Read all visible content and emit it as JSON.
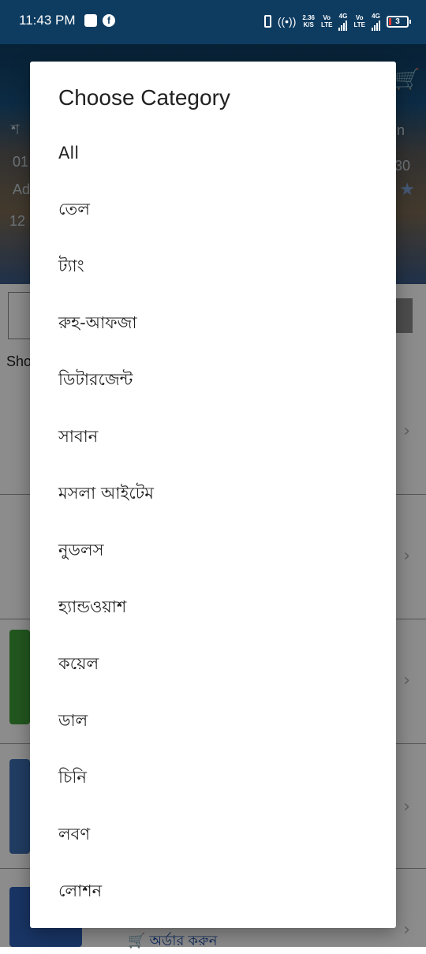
{
  "status_bar": {
    "time": "11:43 PM",
    "data_speed_value": "2.36",
    "data_speed_unit": "K/S",
    "sim1_volte_top": "Vo",
    "sim1_volte_bottom": "LTE",
    "sim1_network": "4G",
    "sim2_volte_top": "Vo",
    "sim2_volte_bottom": "LTE",
    "sim2_network": "4G",
    "battery_level": "3"
  },
  "background": {
    "header_fragments": [
      "শ",
      "01",
      "Ad",
      "12"
    ],
    "header_fragments_right": [
      "n",
      "30"
    ],
    "sho_fragment": "Sho",
    "order_fragment": "অর্ডার করুন"
  },
  "dialog": {
    "title": "Choose Category",
    "categories": [
      "All",
      "তেল",
      "ট্যাং",
      "রুহ-আফজা",
      "ডিটারজেন্ট",
      "সাবান",
      "মসলা আইটেম",
      "নুডলস",
      "হ্যান্ডওয়াশ",
      "কয়েল",
      "ডাল",
      "চিনি",
      "লবণ",
      "লোশন"
    ]
  },
  "colors": {
    "status_bar_bg": "#0e3c61",
    "scrim": "rgba(0,0,0,0.45)",
    "dialog_bg": "#ffffff",
    "text_primary": "#212121",
    "battery_low": "#e53935"
  }
}
